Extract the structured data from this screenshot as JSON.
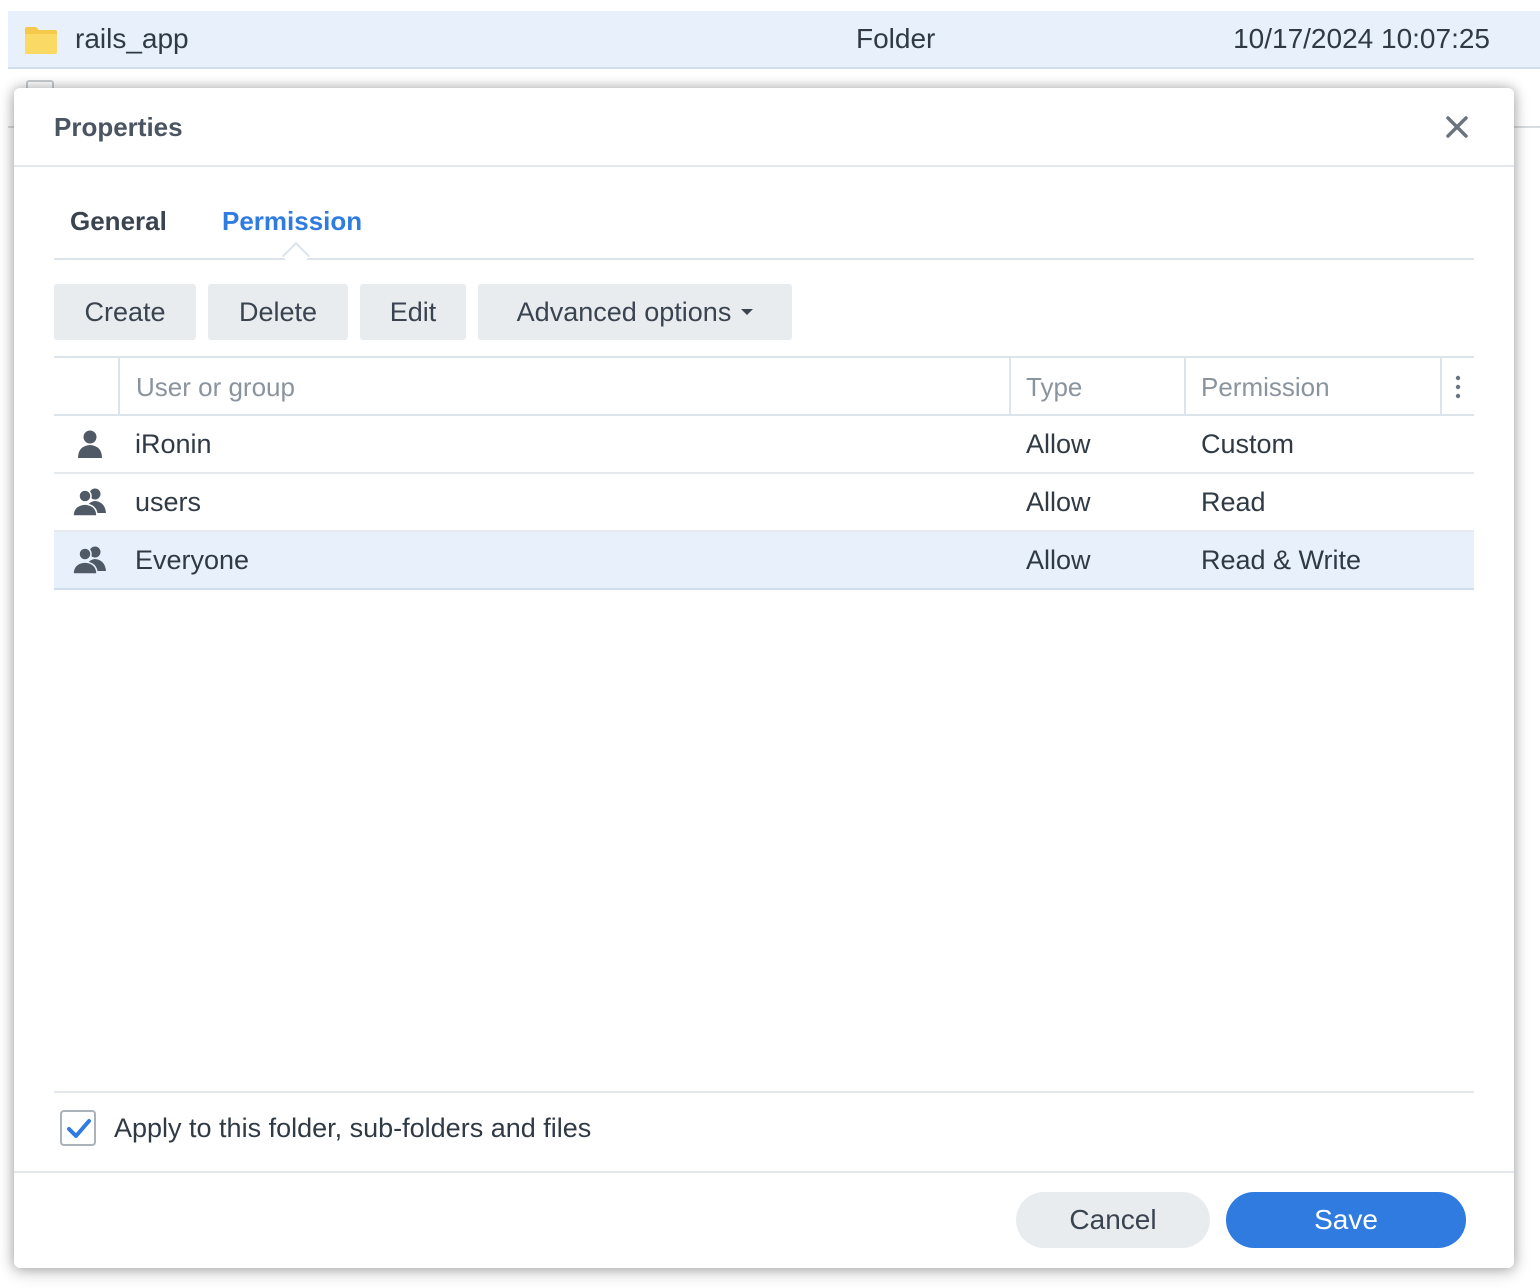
{
  "background_list": {
    "row": {
      "name": "rails_app",
      "kind": "Folder",
      "modified": "10/17/2024 10:07:25"
    }
  },
  "dialog": {
    "title": "Properties",
    "tabs": [
      {
        "label": "General"
      },
      {
        "label": "Permission",
        "active": true
      }
    ],
    "toolbar": {
      "create": "Create",
      "delete": "Delete",
      "edit": "Edit",
      "advanced": "Advanced options"
    },
    "grid": {
      "columns": [
        "User or group",
        "Type",
        "Permission"
      ],
      "rows": [
        {
          "icon": "user-icon",
          "name": "iRonin",
          "type": "Allow",
          "permission": "Custom"
        },
        {
          "icon": "group-icon",
          "name": "users",
          "type": "Allow",
          "permission": "Read"
        },
        {
          "icon": "group-icon",
          "name": "Everyone",
          "type": "Allow",
          "permission": "Read & Write",
          "selected": true
        }
      ]
    },
    "apply_label": "Apply to this folder, sub-folders and files",
    "apply_checked": true,
    "cancel": "Cancel",
    "save": "Save"
  },
  "colors": {
    "accent": "#2f7be0",
    "selected_row": "#e7f0fb"
  }
}
